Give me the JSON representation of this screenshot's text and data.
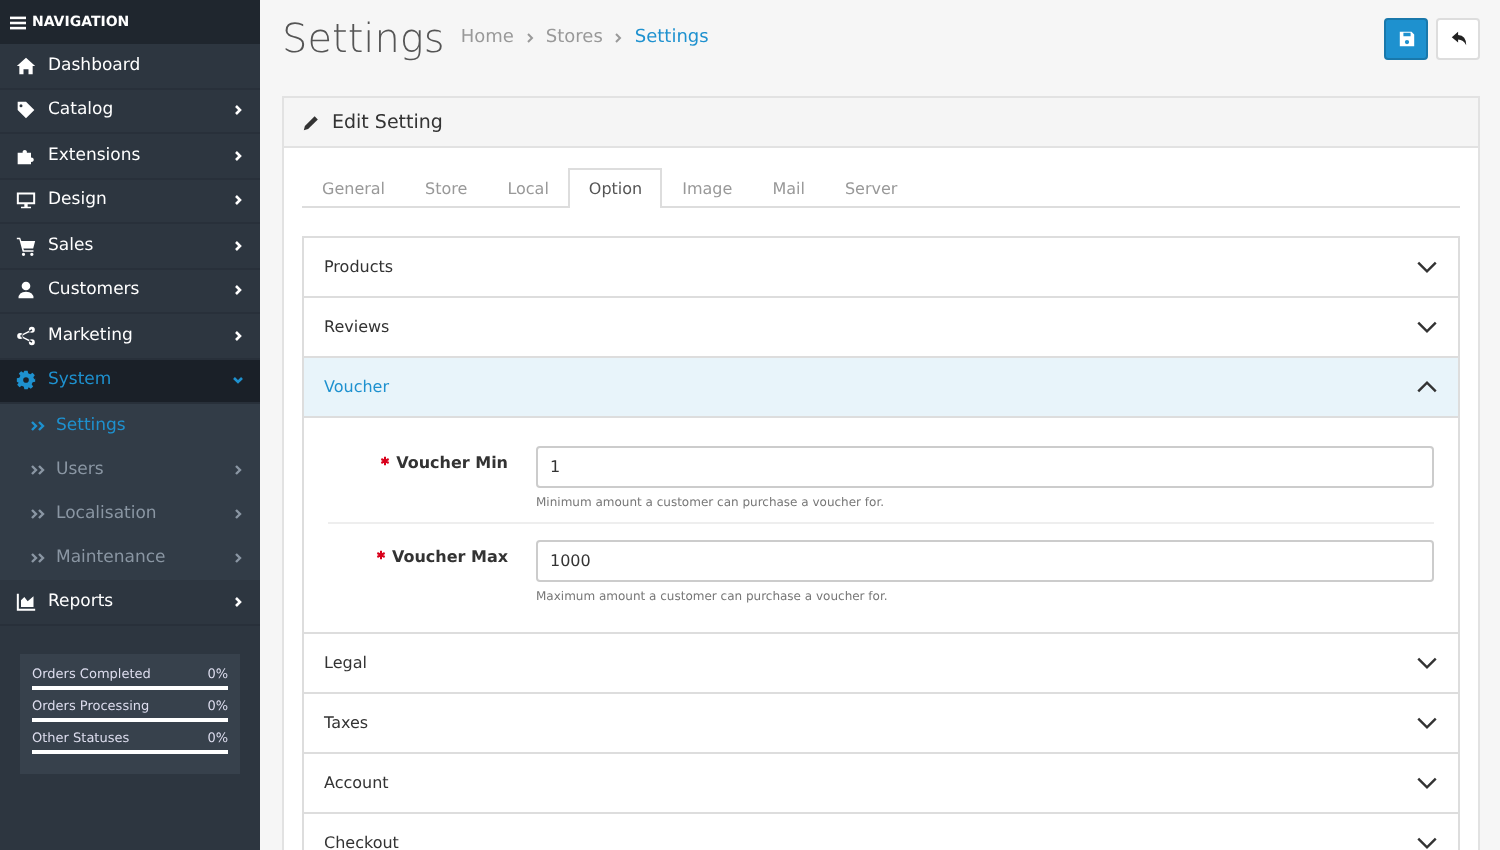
{
  "sidebar": {
    "title": "NAVIGATION",
    "items": [
      {
        "label": "Dashboard",
        "has_children": false,
        "selected": false
      },
      {
        "label": "Catalog",
        "has_children": true,
        "selected": false
      },
      {
        "label": "Extensions",
        "has_children": true,
        "selected": false
      },
      {
        "label": "Design",
        "has_children": true,
        "selected": false
      },
      {
        "label": "Sales",
        "has_children": true,
        "selected": false
      },
      {
        "label": "Customers",
        "has_children": true,
        "selected": false
      },
      {
        "label": "Marketing",
        "has_children": true,
        "selected": false
      },
      {
        "label": "System",
        "has_children": true,
        "selected": true,
        "expanded": true,
        "children": [
          {
            "label": "Settings",
            "has_children": false,
            "selected": true
          },
          {
            "label": "Users",
            "has_children": true,
            "selected": false
          },
          {
            "label": "Localisation",
            "has_children": true,
            "selected": false
          },
          {
            "label": "Maintenance",
            "has_children": true,
            "selected": false
          }
        ]
      },
      {
        "label": "Reports",
        "has_children": true,
        "selected": false
      }
    ],
    "stats": [
      {
        "label": "Orders Completed",
        "reading": "0%"
      },
      {
        "label": "Orders Processing",
        "reading": "0%"
      },
      {
        "label": "Other Statuses",
        "reading": "0%"
      }
    ]
  },
  "page": {
    "title": "Settings",
    "breadcrumb": [
      {
        "label": "Home",
        "selected": false
      },
      {
        "label": "Stores",
        "selected": false
      },
      {
        "label": "Settings",
        "selected": true
      }
    ]
  },
  "panel": {
    "heading": "Edit Setting",
    "tabs": [
      {
        "label": "General",
        "selected": false
      },
      {
        "label": "Store",
        "selected": false
      },
      {
        "label": "Local",
        "selected": false
      },
      {
        "label": "Option",
        "selected": true
      },
      {
        "label": "Image",
        "selected": false
      },
      {
        "label": "Mail",
        "selected": false
      },
      {
        "label": "Server",
        "selected": false
      }
    ],
    "sections": [
      {
        "title": "Products",
        "expanded": false
      },
      {
        "title": "Reviews",
        "expanded": false
      },
      {
        "title": "Voucher",
        "expanded": true,
        "fields": [
          {
            "label": "Voucher Min",
            "required": true,
            "value": "1",
            "help": "Minimum amount a customer can purchase a voucher for."
          },
          {
            "label": "Voucher Max",
            "required": true,
            "value": "1000",
            "help": "Maximum amount a customer can purchase a voucher for."
          }
        ]
      },
      {
        "title": "Legal",
        "expanded": false
      },
      {
        "title": "Taxes",
        "expanded": false
      },
      {
        "title": "Account",
        "expanded": false
      },
      {
        "title": "Checkout",
        "expanded": false
      }
    ]
  }
}
